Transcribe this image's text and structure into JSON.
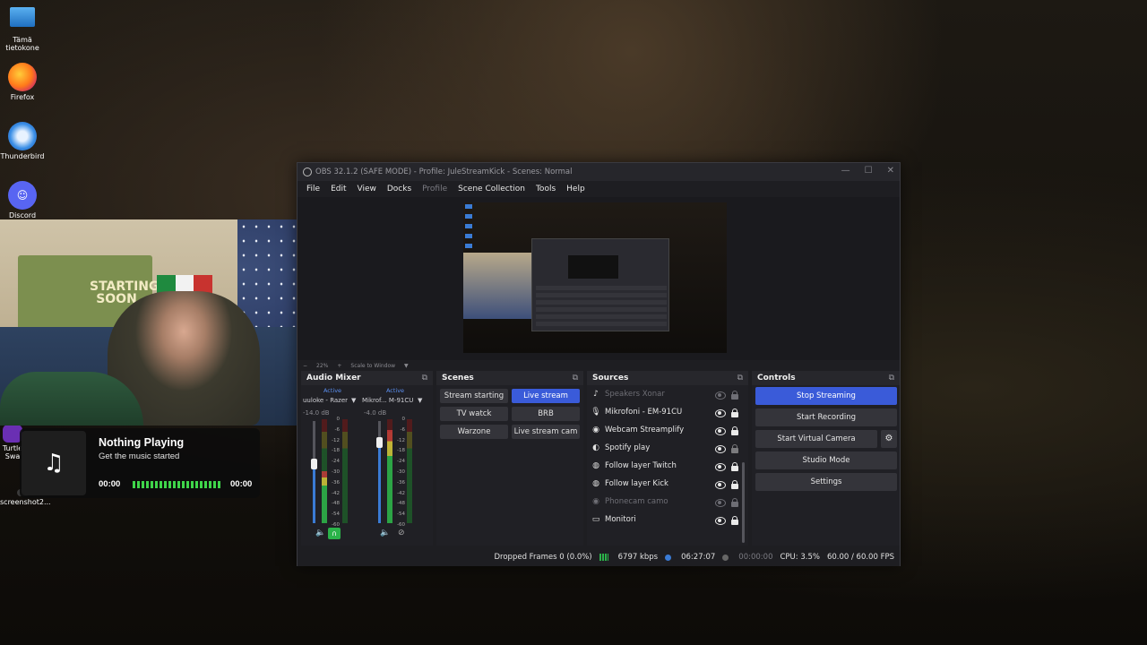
{
  "desktop": {
    "icons": [
      {
        "label_line1": "Tämä",
        "label_line2": "tietokone"
      },
      {
        "label": "Firefox"
      },
      {
        "label": "Thunderbird"
      },
      {
        "label": "Discord"
      },
      {
        "label": "Turtle",
        "label2": "Swa"
      },
      {
        "label": "screenshot2..."
      }
    ]
  },
  "webcam": {
    "poster_text": "STARTING SOON"
  },
  "music": {
    "title": "Nothing Playing",
    "subtitle": "Get the music started",
    "time_start": "00:00",
    "time_end": "00:00",
    "icon": "music-note-icon"
  },
  "obs": {
    "title": "OBS 32.1.2 (SAFE MODE) - Profile: JuleStreamKick - Scenes: Normal",
    "menu": [
      "File",
      "Edit",
      "View",
      "Docks",
      "Profile",
      "Scene Collection",
      "Tools",
      "Help"
    ],
    "zoom": {
      "minus": "−",
      "value": "22%",
      "plus": "+",
      "mode": "Scale to Window"
    },
    "mixer": {
      "title": "Audio Mixer",
      "channels": [
        {
          "active": "Active",
          "name": "uuloke - Razer",
          "db": "-14.0 dB"
        },
        {
          "active": "Active",
          "name": "Mikrof... M-91CU",
          "db": "-4.0 dB"
        }
      ],
      "scale": [
        "0",
        "-6",
        "-12",
        "-18",
        "-24",
        "-30",
        "-36",
        "-42",
        "-48",
        "-54",
        "-60"
      ]
    },
    "scenes": {
      "title": "Scenes",
      "items": [
        "Stream starting",
        "Live stream",
        "TV watck",
        "BRB",
        "Warzone",
        "Live stream cam"
      ],
      "active": "Live stream"
    },
    "sources": {
      "title": "Sources",
      "items": [
        {
          "name": "Speakers Xonar",
          "icon": "speaker-icon",
          "visible": false
        },
        {
          "name": "Mikrofoni - EM-91CU",
          "icon": "microphone-icon",
          "visible": true
        },
        {
          "name": "Webcam Streamplify",
          "icon": "camera-icon",
          "visible": true
        },
        {
          "name": "Spotify play",
          "icon": "window-capture-icon",
          "visible": true
        },
        {
          "name": "Follow layer Twitch",
          "icon": "browser-icon",
          "visible": true
        },
        {
          "name": "Follow layer Kick",
          "icon": "browser-icon",
          "visible": true
        },
        {
          "name": "Phonecam camo",
          "icon": "camera-icon",
          "visible": false
        },
        {
          "name": "Monitori",
          "icon": "monitor-icon",
          "visible": true
        }
      ]
    },
    "controls": {
      "title": "Controls",
      "stop_streaming": "Stop Streaming",
      "start_recording": "Start Recording",
      "start_virtual_camera": "Start Virtual Camera",
      "studio_mode": "Studio Mode",
      "settings": "Settings"
    },
    "status": {
      "dropped": "Dropped Frames 0 (0.0%)",
      "bitrate": "6797 kbps",
      "stream_time": "06:27:07",
      "rec_time": "00:00:00",
      "cpu": "CPU: 3.5%",
      "fps": "60.00 / 60.00 FPS"
    }
  }
}
